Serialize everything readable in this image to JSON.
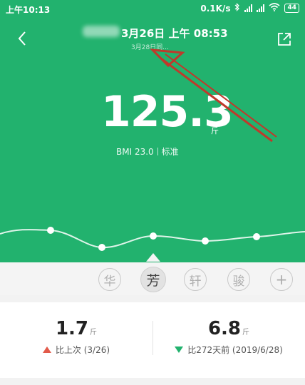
{
  "status_bar": {
    "time": "上午10:13",
    "net_speed": "0.1K/s",
    "battery": "44"
  },
  "header": {
    "title": "3月26日 上午 08:53",
    "subtitle": "3月28日同..."
  },
  "measurement": {
    "weight": "125.3",
    "unit": "斤",
    "bmi": "BMI 23.0",
    "bmi_status": "标准"
  },
  "users": [
    {
      "label": "华",
      "active": false
    },
    {
      "label": "芳",
      "active": true
    },
    {
      "label": "轩",
      "active": false
    },
    {
      "label": "骏",
      "active": false
    }
  ],
  "add_user_label": "+",
  "stats": {
    "previous": {
      "value": "1.7",
      "unit": "斤",
      "label": "比上次 (3/26)"
    },
    "earlier": {
      "value": "6.8",
      "unit": "斤",
      "label": "比272天前 (2019/6/28)"
    }
  },
  "colors": {
    "primary_green": "#22b26e",
    "up_red": "#e25a4a",
    "annotation_arrow": "#c0392b"
  }
}
